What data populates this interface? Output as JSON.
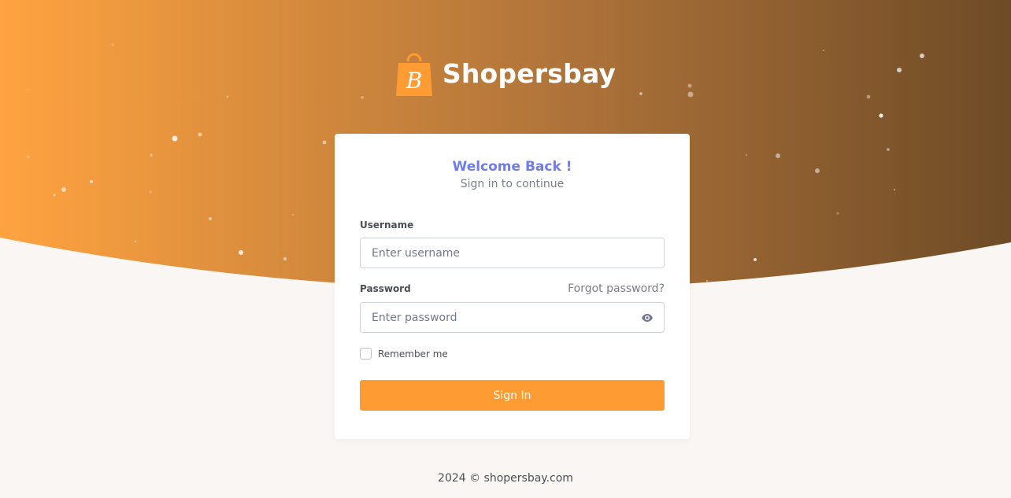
{
  "brand": {
    "name": "Shopersbay",
    "logo_letter": "B",
    "colors": {
      "accent": "#ff9b33",
      "hero_start": "#ffa340",
      "hero_end": "#6e4b26",
      "welcome": "#6f7bf0"
    }
  },
  "login": {
    "title": "Welcome Back !",
    "subtitle": "Sign in to continue",
    "username_label": "Username",
    "username_placeholder": "Enter username",
    "username_value": "",
    "password_label": "Password",
    "forgot_label": "Forgot password?",
    "password_placeholder": "Enter password",
    "password_value": "",
    "remember_label": "Remember me",
    "remember_checked": false,
    "submit_label": "Sign In"
  },
  "footer": {
    "text": "2024 © shopersbay.com"
  },
  "icons": {
    "logo": "shopping-bag-icon",
    "password_toggle": "eye-icon"
  }
}
